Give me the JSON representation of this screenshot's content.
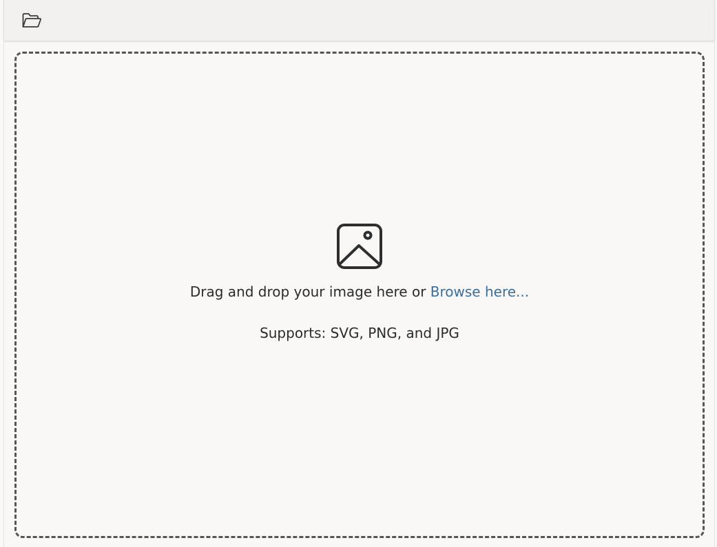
{
  "toolbar": {
    "open_icon": "folder-open-icon"
  },
  "dropzone": {
    "icon": "image-icon",
    "prompt_text": "Drag and drop your image here or ",
    "browse_label": "Browse here...",
    "supports_text": "Supports: SVG, PNG, and JPG"
  },
  "colors": {
    "background": "#f9f8f6",
    "toolbar_bg": "#f1f0ee",
    "link": "#3b6f99",
    "border": "#555555",
    "text": "#2b2b2b"
  }
}
